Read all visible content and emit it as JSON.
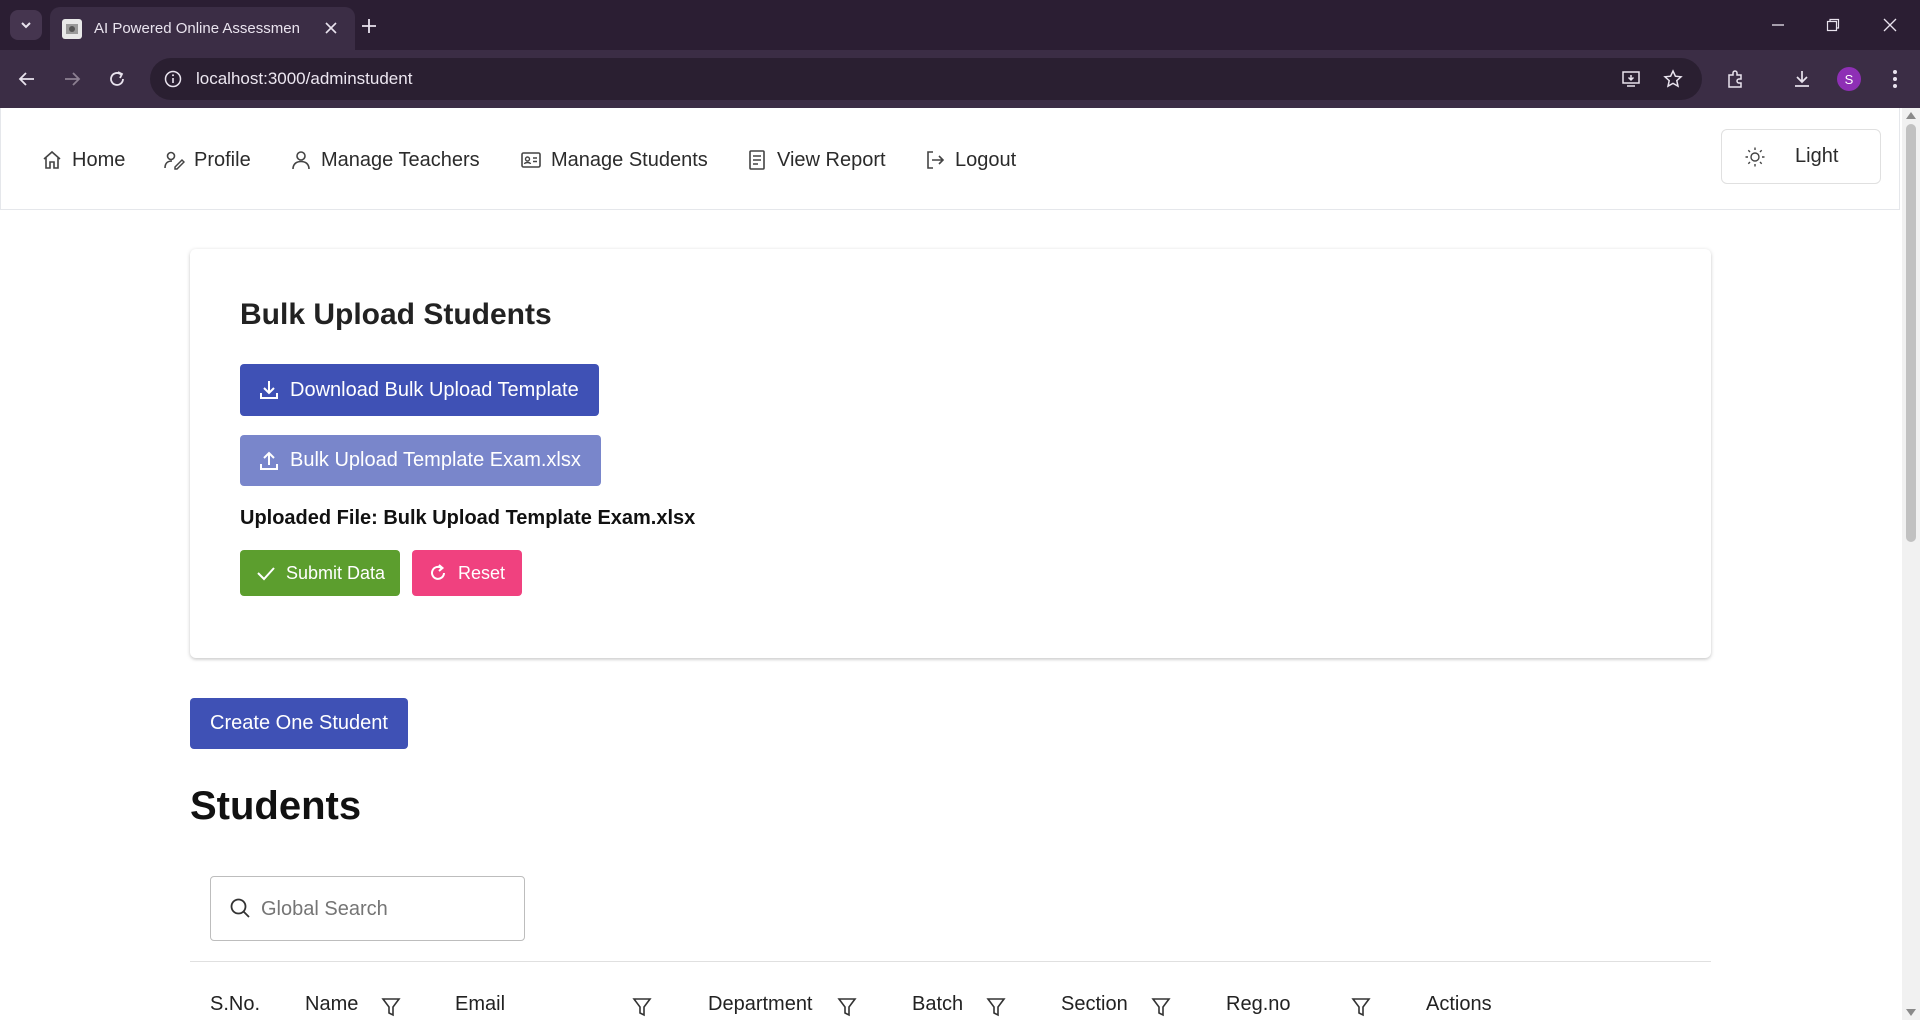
{
  "browser": {
    "tab_title": "AI Powered Online Assessment",
    "url": "localhost:3000/adminstudent",
    "profile_initial": "S"
  },
  "nav": {
    "items": [
      {
        "label": "Home",
        "icon": "home-icon"
      },
      {
        "label": "Profile",
        "icon": "user-edit-icon"
      },
      {
        "label": "Manage Teachers",
        "icon": "user-icon"
      },
      {
        "label": "Manage Students",
        "icon": "id-card-icon"
      },
      {
        "label": "View Report",
        "icon": "report-icon"
      },
      {
        "label": "Logout",
        "icon": "logout-icon"
      }
    ],
    "theme_label": "Light"
  },
  "bulk_upload": {
    "title": "Bulk Upload Students",
    "download_label": "Download Bulk Upload Template",
    "upload_label": "Bulk Upload Template Exam.xlsx",
    "uploaded_file_text": "Uploaded File: Bulk Upload Template Exam.xlsx",
    "submit_label": "Submit Data",
    "reset_label": "Reset"
  },
  "students": {
    "create_label": "Create One Student",
    "title": "Students",
    "search_placeholder": "Global Search",
    "columns": [
      "S.No.",
      "Name",
      "Email",
      "Department",
      "Batch",
      "Section",
      "Reg.no",
      "Actions"
    ]
  },
  "colors": {
    "primary": "#3f51b5",
    "upload_button": "#7986cb",
    "submit": "#5c9e2e",
    "reset": "#f0417f",
    "browser_frame": "#2b1e33"
  }
}
